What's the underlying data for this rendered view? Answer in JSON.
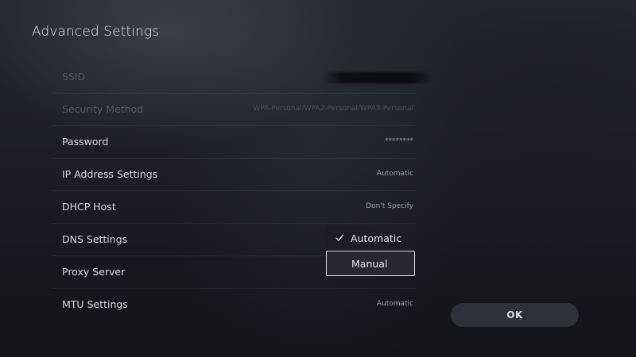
{
  "header": {
    "title": "Advanced Settings"
  },
  "settings": {
    "rows": [
      {
        "label": "SSID",
        "value": ""
      },
      {
        "label": "Security Method",
        "value": "WPA-Personal/WPA2-Personal/WPA3-Personal"
      },
      {
        "label": "Password",
        "value": "********"
      },
      {
        "label": "IP Address Settings",
        "value": "Automatic"
      },
      {
        "label": "DHCP Host",
        "value": "Don't Specify"
      },
      {
        "label": "DNS Settings",
        "value": ""
      },
      {
        "label": "Proxy Server",
        "value": ""
      },
      {
        "label": "MTU Settings",
        "value": "Automatic"
      }
    ]
  },
  "dns_dropdown": {
    "options": [
      {
        "label": "Automatic",
        "selected": true,
        "icon": "check-icon"
      },
      {
        "label": "Manual",
        "selected": false,
        "focused": true
      }
    ]
  },
  "ok_button": {
    "label": "OK"
  },
  "colors": {
    "background": "#1c1f26",
    "focus_border": "#d9dbe0",
    "text_primary": "#d4d7dd",
    "text_disabled": "#545a65"
  }
}
